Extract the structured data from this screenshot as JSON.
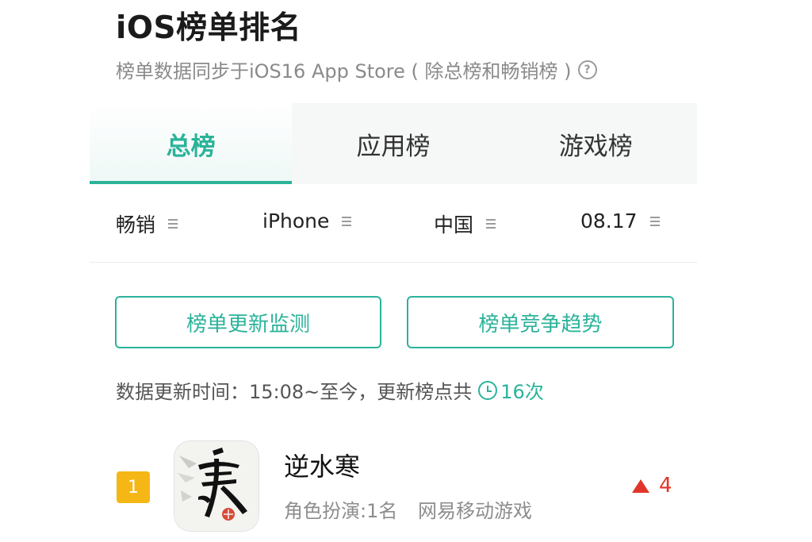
{
  "header": {
    "title": "iOS榜单排名",
    "subtitle": "榜单数据同步于iOS16 App Store ( 除总榜和畅销榜 )",
    "help_icon": "?"
  },
  "tabs": [
    {
      "label": "总榜",
      "active": true
    },
    {
      "label": "应用榜",
      "active": false
    },
    {
      "label": "游戏榜",
      "active": false
    }
  ],
  "filters": {
    "list_type": "畅销",
    "device": "iPhone",
    "region": "中国",
    "date": "08.17"
  },
  "actions": {
    "monitor_label": "榜单更新监测",
    "trend_label": "榜单竞争趋势"
  },
  "update": {
    "text": "数据更新时间：15:08~至今，更新榜点共",
    "count": "16次"
  },
  "ranking": [
    {
      "rank": "1",
      "name": "逆水寒",
      "category": "角色扮演:1名",
      "developer": "网易移动游戏",
      "change": "4",
      "change_direction": "up"
    }
  ],
  "colors": {
    "accent": "#2bb39a",
    "rank_badge": "#f5b716",
    "trend_up": "#e0362a"
  }
}
